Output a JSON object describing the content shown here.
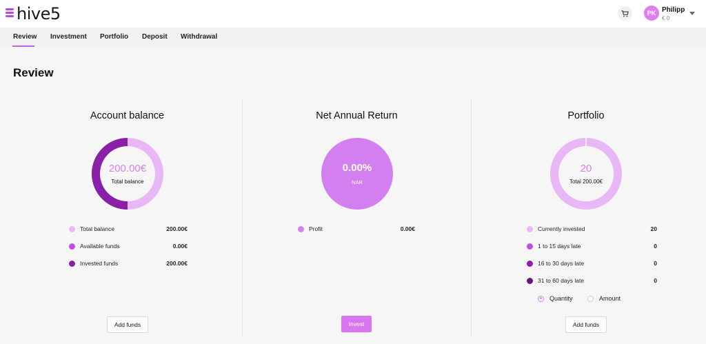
{
  "header": {
    "brand": "hive5",
    "user_initials": "PK",
    "user_name": "Philipp",
    "user_balance": "€ 0"
  },
  "tabs": [
    {
      "label": "Review",
      "active": true
    },
    {
      "label": "Investment"
    },
    {
      "label": "Portfolio"
    },
    {
      "label": "Deposit"
    },
    {
      "label": "Withdrawal"
    }
  ],
  "page": {
    "title": "Review"
  },
  "account_balance": {
    "title": "Account balance",
    "center_value": "200.00€",
    "center_label": "Total balance",
    "legend": [
      {
        "label": "Total balance",
        "value": "200.00€",
        "color": "#e8b7f5"
      },
      {
        "label": "Available funds",
        "value": "0.00€",
        "color": "#c34fe0"
      },
      {
        "label": "Invested funds",
        "value": "200.00€",
        "color": "#8a1fa8"
      }
    ],
    "button": "Add funds"
  },
  "net_annual_return": {
    "title": "Net Annual Return",
    "center_value": "0.00%",
    "center_label": "NAR",
    "legend": [
      {
        "label": "Profit",
        "value": "0.00€",
        "color": "#d37ff0"
      }
    ],
    "button": "Invest"
  },
  "portfolio": {
    "title": "Portfolio",
    "center_value": "20",
    "center_label": "Total 200.00€",
    "legend": [
      {
        "label": "Currently invested",
        "value": "20",
        "color": "#e8b7f5"
      },
      {
        "label": "1 to 15 days late",
        "value": "0",
        "color": "#c34fe0"
      },
      {
        "label": "16 to 30 days late",
        "value": "0",
        "color": "#8a1fa8"
      },
      {
        "label": "31 to 60 days late",
        "value": "0",
        "color": "#6a1480"
      }
    ],
    "radio_options": [
      {
        "label": "Quantity",
        "selected": true
      },
      {
        "label": "Amount",
        "selected": false
      }
    ],
    "button": "Add funds"
  },
  "colors": {
    "accent": "#c35fe3",
    "light": "#e8b7f5",
    "invested": "#8a1fa8",
    "nar_fill": "#d37ff0"
  },
  "icons": {
    "menu": "menu-icon",
    "cart": "cart-icon",
    "caret": "chevron-down-icon"
  }
}
